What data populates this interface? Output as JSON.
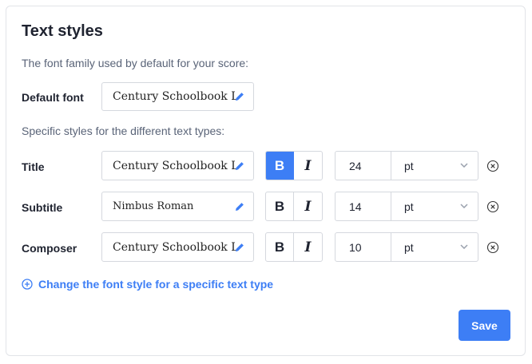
{
  "title": "Text styles",
  "default_desc": "The font family used by default for your score:",
  "default_font": {
    "label": "Default font",
    "value": "Century Schoolbook L"
  },
  "specific_desc": "Specific styles for the different text types:",
  "rows": [
    {
      "label": "Title",
      "font": "Century Schoolbook L",
      "bold": true,
      "italic": false,
      "size": "24",
      "unit": "pt"
    },
    {
      "label": "Subtitle",
      "font": "Nimbus Roman",
      "bold": false,
      "italic": false,
      "size": "14",
      "unit": "pt"
    },
    {
      "label": "Composer",
      "font": "Century Schoolbook L",
      "bold": false,
      "italic": false,
      "size": "10",
      "unit": "pt"
    }
  ],
  "bold_label": "B",
  "italic_label": "I",
  "add_link": "Change the font style for a specific text type",
  "save_label": "Save",
  "accent": "#3d7ef5"
}
